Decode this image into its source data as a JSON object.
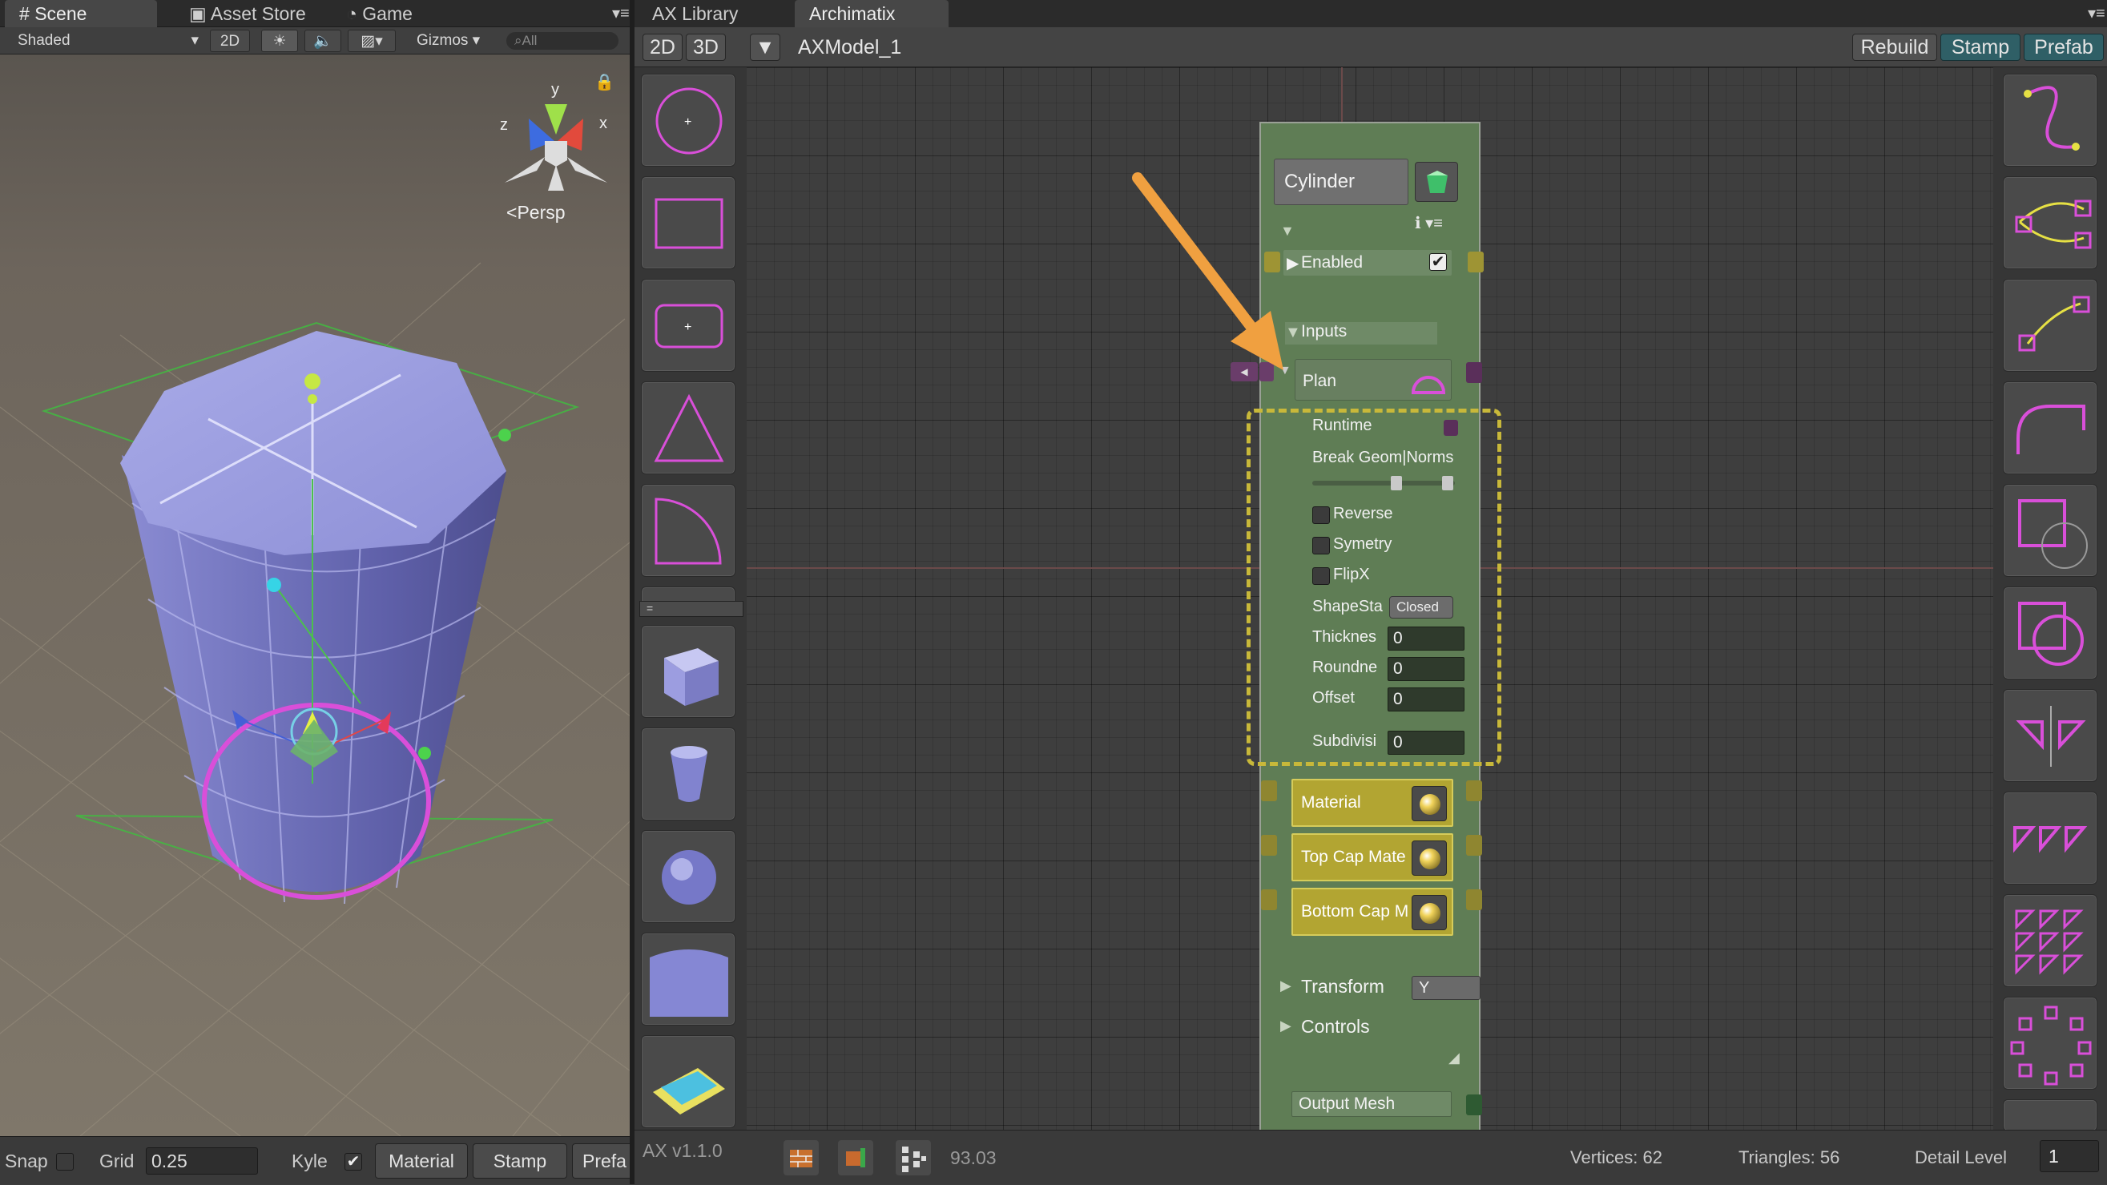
{
  "scene_window": {
    "tabs": [
      {
        "label": "Scene",
        "icon": "hash-icon"
      },
      {
        "label": "Asset Store",
        "icon": "store-icon"
      },
      {
        "label": "Game",
        "icon": "pacman-icon"
      }
    ],
    "toolbar": {
      "shading": "Shaded",
      "mode_2d": "2D",
      "gizmos": "Gizmos",
      "search_placeholder": "All"
    },
    "gizmo": {
      "y": "y",
      "x": "x",
      "z": "z",
      "projection": "Persp"
    },
    "bottom": {
      "snap_label": "Snap",
      "grid_label": "Grid",
      "grid_value": "0.25",
      "kyle_label": "Kyle",
      "material": "Material",
      "stamp": "Stamp",
      "prefab": "Prefa"
    }
  },
  "ax_window": {
    "tabs": [
      {
        "label": "AX Library"
      },
      {
        "label": "Archimatix"
      }
    ],
    "toolbar": {
      "btn_2d": "2D",
      "btn_3d": "3D",
      "model_name": "AXModel_1",
      "rebuild": "Rebuild",
      "stamp": "Stamp",
      "prefab": "Prefab"
    },
    "status": {
      "version": "AX v1.1.0",
      "counter": "93.03",
      "vertices": "Vertices: 62",
      "triangles": "Triangles: 56",
      "detail_label": "Detail Level",
      "detail_value": "1"
    }
  },
  "node": {
    "title": "Cylinder",
    "enabled_label": "Enabled",
    "inputs_label": "Inputs",
    "plan_label": "Plan",
    "params": {
      "runtime": "Runtime",
      "break": "Break Geom|Norms",
      "reverse": "Reverse",
      "symmetry": "Symetry",
      "flipx": "FlipX",
      "shapestate": "ShapeSta",
      "shapestate_value": "Closed",
      "thickness": "Thicknes",
      "thickness_value": "0",
      "roundness": "Roundne",
      "roundness_value": "0",
      "offset": "Offset",
      "offset_value": "0",
      "subdiv": "Subdivisi",
      "subdiv_value": "0"
    },
    "material": "Material",
    "top_cap": "Top Cap Mate",
    "bottom_cap": "Bottom Cap M",
    "transform": "Transform",
    "transform_axis": "Y",
    "controls": "Controls",
    "output": "Output Mesh"
  },
  "colors": {
    "accent_magenta": "#d94fd9",
    "node_green": "#5f7d55",
    "highlight_yellow": "#c8b83a",
    "arrow_orange": "#f0a040",
    "teal_button": "#2f5f66"
  }
}
